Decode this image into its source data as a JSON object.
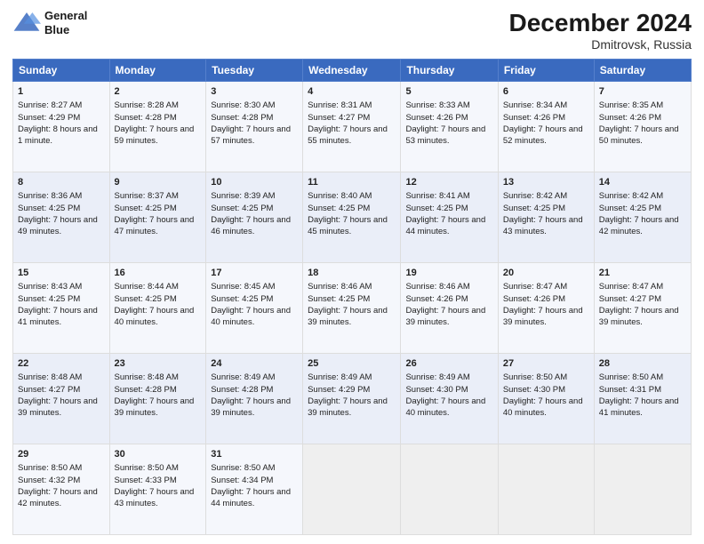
{
  "logo": {
    "line1": "General",
    "line2": "Blue"
  },
  "title": "December 2024",
  "subtitle": "Dmitrovsk, Russia",
  "headers": [
    "Sunday",
    "Monday",
    "Tuesday",
    "Wednesday",
    "Thursday",
    "Friday",
    "Saturday"
  ],
  "weeks": [
    [
      {
        "day": "1",
        "sunrise": "8:27 AM",
        "sunset": "4:29 PM",
        "daylight": "8 hours and 1 minute."
      },
      {
        "day": "2",
        "sunrise": "8:28 AM",
        "sunset": "4:28 PM",
        "daylight": "7 hours and 59 minutes."
      },
      {
        "day": "3",
        "sunrise": "8:30 AM",
        "sunset": "4:28 PM",
        "daylight": "7 hours and 57 minutes."
      },
      {
        "day": "4",
        "sunrise": "8:31 AM",
        "sunset": "4:27 PM",
        "daylight": "7 hours and 55 minutes."
      },
      {
        "day": "5",
        "sunrise": "8:33 AM",
        "sunset": "4:26 PM",
        "daylight": "7 hours and 53 minutes."
      },
      {
        "day": "6",
        "sunrise": "8:34 AM",
        "sunset": "4:26 PM",
        "daylight": "7 hours and 52 minutes."
      },
      {
        "day": "7",
        "sunrise": "8:35 AM",
        "sunset": "4:26 PM",
        "daylight": "7 hours and 50 minutes."
      }
    ],
    [
      {
        "day": "8",
        "sunrise": "8:36 AM",
        "sunset": "4:25 PM",
        "daylight": "7 hours and 49 minutes."
      },
      {
        "day": "9",
        "sunrise": "8:37 AM",
        "sunset": "4:25 PM",
        "daylight": "7 hours and 47 minutes."
      },
      {
        "day": "10",
        "sunrise": "8:39 AM",
        "sunset": "4:25 PM",
        "daylight": "7 hours and 46 minutes."
      },
      {
        "day": "11",
        "sunrise": "8:40 AM",
        "sunset": "4:25 PM",
        "daylight": "7 hours and 45 minutes."
      },
      {
        "day": "12",
        "sunrise": "8:41 AM",
        "sunset": "4:25 PM",
        "daylight": "7 hours and 44 minutes."
      },
      {
        "day": "13",
        "sunrise": "8:42 AM",
        "sunset": "4:25 PM",
        "daylight": "7 hours and 43 minutes."
      },
      {
        "day": "14",
        "sunrise": "8:42 AM",
        "sunset": "4:25 PM",
        "daylight": "7 hours and 42 minutes."
      }
    ],
    [
      {
        "day": "15",
        "sunrise": "8:43 AM",
        "sunset": "4:25 PM",
        "daylight": "7 hours and 41 minutes."
      },
      {
        "day": "16",
        "sunrise": "8:44 AM",
        "sunset": "4:25 PM",
        "daylight": "7 hours and 40 minutes."
      },
      {
        "day": "17",
        "sunrise": "8:45 AM",
        "sunset": "4:25 PM",
        "daylight": "7 hours and 40 minutes."
      },
      {
        "day": "18",
        "sunrise": "8:46 AM",
        "sunset": "4:25 PM",
        "daylight": "7 hours and 39 minutes."
      },
      {
        "day": "19",
        "sunrise": "8:46 AM",
        "sunset": "4:26 PM",
        "daylight": "7 hours and 39 minutes."
      },
      {
        "day": "20",
        "sunrise": "8:47 AM",
        "sunset": "4:26 PM",
        "daylight": "7 hours and 39 minutes."
      },
      {
        "day": "21",
        "sunrise": "8:47 AM",
        "sunset": "4:27 PM",
        "daylight": "7 hours and 39 minutes."
      }
    ],
    [
      {
        "day": "22",
        "sunrise": "8:48 AM",
        "sunset": "4:27 PM",
        "daylight": "7 hours and 39 minutes."
      },
      {
        "day": "23",
        "sunrise": "8:48 AM",
        "sunset": "4:28 PM",
        "daylight": "7 hours and 39 minutes."
      },
      {
        "day": "24",
        "sunrise": "8:49 AM",
        "sunset": "4:28 PM",
        "daylight": "7 hours and 39 minutes."
      },
      {
        "day": "25",
        "sunrise": "8:49 AM",
        "sunset": "4:29 PM",
        "daylight": "7 hours and 39 minutes."
      },
      {
        "day": "26",
        "sunrise": "8:49 AM",
        "sunset": "4:30 PM",
        "daylight": "7 hours and 40 minutes."
      },
      {
        "day": "27",
        "sunrise": "8:50 AM",
        "sunset": "4:30 PM",
        "daylight": "7 hours and 40 minutes."
      },
      {
        "day": "28",
        "sunrise": "8:50 AM",
        "sunset": "4:31 PM",
        "daylight": "7 hours and 41 minutes."
      }
    ],
    [
      {
        "day": "29",
        "sunrise": "8:50 AM",
        "sunset": "4:32 PM",
        "daylight": "7 hours and 42 minutes."
      },
      {
        "day": "30",
        "sunrise": "8:50 AM",
        "sunset": "4:33 PM",
        "daylight": "7 hours and 43 minutes."
      },
      {
        "day": "31",
        "sunrise": "8:50 AM",
        "sunset": "4:34 PM",
        "daylight": "7 hours and 44 minutes."
      },
      null,
      null,
      null,
      null
    ]
  ],
  "labels": {
    "sunrise": "Sunrise:",
    "sunset": "Sunset:",
    "daylight": "Daylight:"
  }
}
